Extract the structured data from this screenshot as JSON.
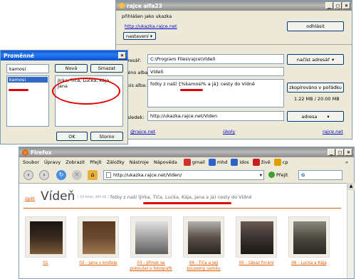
{
  "rajce": {
    "title": "rajce alfa23",
    "logged_in": "přihlášen jako ukazka",
    "url": "http://ukazka.rajce.net",
    "settings_btn": "nastavení",
    "logout_btn": "odhlásit",
    "dir_label": "Adresář:",
    "dir_value": "C:\\Program Files\\rajce\\Víd­eň",
    "album_label": "Jméno alba:",
    "album_value": "Vídeň",
    "desc_label": "Popis alba:",
    "desc_value": "fotky z naší {%kamosi% a já} cesty do Vídně",
    "load_dir_btn": "načíst adresář",
    "copied_btn": "zkopírováno v pořádku",
    "size_text": "1.22 MB / 20.00 MB",
    "result_label": "Výsledek:",
    "result_value": "http://ukazka.rajce.net/Viden",
    "address_btn": "adresa",
    "footer_left": "@rajce.net",
    "footer_mid": "úkoly",
    "footer_right": "rajce.net"
  },
  "vars": {
    "title": "Proměnné",
    "input_value": "kamosi",
    "list_item": "kamosi",
    "new_btn": "Nová",
    "delete_btn": "Smazat",
    "value_text": "Jirka, Tiča, Lucka, Kája, Jana",
    "ok_btn": "OK",
    "cancel_btn": "Storno"
  },
  "firefox": {
    "title": "Firefox",
    "menu": [
      "Soubor",
      "Úpravy",
      "Zobrazit",
      "Přejít",
      "Záložky",
      "Nástroje",
      "Nápověda"
    ],
    "bookmarks": [
      {
        "label": "gmail",
        "color": "#d03030"
      },
      {
        "label": "mhd",
        "color": "#2a64c8"
      },
      {
        "label": "idos",
        "color": "#2a64c8"
      },
      {
        "label": "živě",
        "color": "#c81e1e"
      },
      {
        "label": "cp",
        "color": "#e0a000"
      }
    ],
    "url": "http://ukazka.rajce.net/Viden/",
    "go_label": "Přejít",
    "back_link": "zpět",
    "page_title": "Vídeň",
    "page_meta": "[ 10 fotek, 490 kB ]",
    "page_desc": "fotky z naší (Jirka, Tiča, Lucka, Kája, Jana a já) cesty do Vídně",
    "thumbs": [
      {
        "label": "01",
        "tone": "#3a2a20"
      },
      {
        "label": "02 - Jana v kostele",
        "tone": "#6a4a30"
      },
      {
        "label": "03 - Jiřinek se pokoušel o fotografii",
        "tone": "#a0a0a0"
      },
      {
        "label": "04 - Tiča a její kouzelný úsměv",
        "tone": "#5a5048"
      },
      {
        "label": "05 - zákaz focení",
        "tone": "#3a3230"
      },
      {
        "label": "06 - Lucka a Kája",
        "tone": "#4a4a40"
      }
    ],
    "colors": {
      "accent": "#e05a00"
    }
  }
}
